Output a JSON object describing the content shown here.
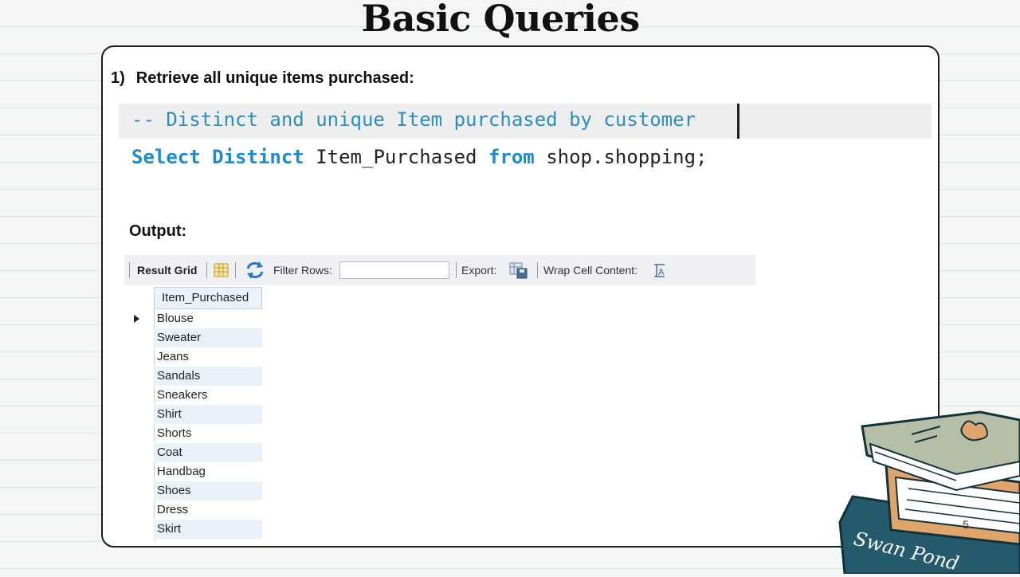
{
  "slide": {
    "title": "Basic Queries",
    "page_number": "5"
  },
  "question": {
    "number": "1)",
    "text": "Retrieve all unique items purchased:"
  },
  "code": {
    "comment": "-- Distinct and unique Item purchased by customer",
    "kw_select": "Select",
    "kw_distinct": "Distinct",
    "column": "Item_Purchased",
    "kw_from": "from",
    "table": "shop.shopping;"
  },
  "output_label": "Output:",
  "toolbar": {
    "result_grid": "Result Grid",
    "filter_rows": "Filter Rows:",
    "filter_value": "",
    "export": "Export:",
    "wrap_cell": "Wrap Cell Content:"
  },
  "grid": {
    "column": "Item_Purchased",
    "rows": [
      "Blouse",
      "Sweater",
      "Jeans",
      "Sandals",
      "Sneakers",
      "Shirt",
      "Shorts",
      "Coat",
      "Handbag",
      "Shoes",
      "Dress",
      "Skirt"
    ]
  },
  "illustration": {
    "book_text": "Swan Pond"
  },
  "colors": {
    "keyword": "#1c8ccf",
    "comment": "#2c8dbf",
    "book_teal": "#245a6b",
    "book_orange": "#e0a56b",
    "book_sage": "#b6bea8"
  }
}
